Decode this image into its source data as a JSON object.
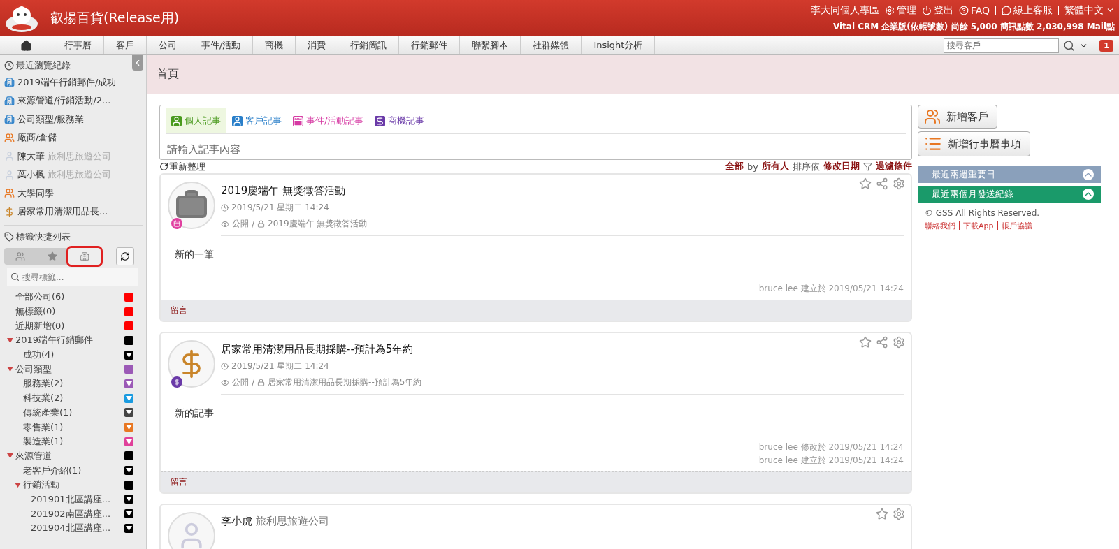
{
  "header": {
    "brand": "叡揚百貨(Release用)",
    "links": [
      {
        "kind": "text",
        "label": "李大同個人專區"
      },
      {
        "kind": "gear",
        "label": "管理"
      },
      {
        "kind": "power",
        "label": "登出"
      },
      {
        "kind": "help",
        "label": "FAQ"
      },
      {
        "kind": "chat",
        "label": "線上客服"
      },
      {
        "kind": "lang",
        "label": "繁體中文"
      }
    ],
    "account": "Vital CRM 企業版(依帳號數)  尚餘 5,000 簡訊點數 2,030,998 Mail點"
  },
  "nav": {
    "tabs": [
      "行事曆",
      "客戶",
      "公司",
      "事件/活動",
      "商機",
      "消費",
      "行銷簡訊",
      "行銷郵件",
      "聯繫腳本",
      "社群媒體",
      "Insight分析"
    ],
    "search_placeholder": "搜尋客戶",
    "badge": "1"
  },
  "sidebar": {
    "recent_title": "最近瀏覽紀錄",
    "recent": [
      {
        "kind": "tag-blue",
        "label": "2019端午行銷郵件/成功"
      },
      {
        "kind": "tag-blue",
        "label": "來源管道/行銷活動/2..."
      },
      {
        "kind": "tag-blue",
        "label": "公司類型/服務業"
      },
      {
        "kind": "tag-orange",
        "label": "廠商/倉儲"
      },
      {
        "kind": "person",
        "label": "陳大華",
        "company": "旅利思旅遊公司"
      },
      {
        "kind": "person",
        "label": "葉小楓",
        "company": "旅利思旅遊公司"
      },
      {
        "kind": "tag-orange",
        "label": "大學同學"
      },
      {
        "kind": "moneybag",
        "label": "居家常用清潔用品長..."
      }
    ],
    "tags_title": "標籤快捷列表",
    "tag_tabs": [
      {
        "kind": "people",
        "selected": false
      },
      {
        "kind": "star",
        "selected": false
      },
      {
        "kind": "company",
        "selected": true
      }
    ],
    "tag_search_placeholder": "搜尋標籤...",
    "tags": [
      {
        "label": "全部公司(6)",
        "kind": "plain",
        "color": "#ff0000"
      },
      {
        "label": "無標籤(0)",
        "kind": "plain",
        "color": "#ff0000"
      },
      {
        "label": "近期新增(0)",
        "kind": "plain",
        "color": "#ff0000"
      },
      {
        "label": "2019端午行銷郵件",
        "kind": "plain",
        "color": "#000000",
        "expanded": true,
        "children": [
          {
            "label": "成功(4)",
            "kind": "menu",
            "color": "#000000"
          }
        ]
      },
      {
        "label": "公司類型",
        "kind": "plain",
        "color": "#9b59b6",
        "expanded": true,
        "children": [
          {
            "label": "服務業(2)",
            "kind": "menu",
            "color": "#9b59b6"
          },
          {
            "label": "科技業(2)",
            "kind": "menu",
            "color": "#1a9be0"
          },
          {
            "label": "傳統產業(1)",
            "kind": "menu",
            "color": "#444444"
          },
          {
            "label": "零售業(1)",
            "kind": "menu",
            "color": "#e87722"
          },
          {
            "label": "製造業(1)",
            "kind": "menu",
            "color": "#e0409a"
          }
        ]
      },
      {
        "label": "來源管道",
        "kind": "plain",
        "color": "#000000",
        "expanded": true,
        "children": [
          {
            "label": "老客戶介紹(1)",
            "kind": "menu",
            "color": "#000000"
          },
          {
            "label": "行銷活動",
            "kind": "plain",
            "color": "#000000",
            "expanded": true,
            "children": [
              {
                "label": "201901北區講座...",
                "kind": "menu",
                "color": "#000000"
              },
              {
                "label": "201902南區講座...",
                "kind": "menu",
                "color": "#000000"
              },
              {
                "label": "201904北區講座...",
                "kind": "menu",
                "color": "#000000"
              }
            ]
          }
        ]
      }
    ]
  },
  "page_title": "首頁",
  "composer": {
    "tabs": [
      {
        "kind": "personal",
        "label": "個人記事",
        "selected": true
      },
      {
        "kind": "customer",
        "label": "客戶記事",
        "selected": false
      },
      {
        "kind": "event",
        "label": "事件/活動記事",
        "selected": false
      },
      {
        "kind": "deal",
        "label": "商機記事",
        "selected": false
      }
    ],
    "placeholder": "請輸入記事內容"
  },
  "feed_bar": {
    "refresh": "重新整理",
    "scope": "全部",
    "by": "by",
    "owner": "所有人",
    "sort_label": "排序依",
    "sort": "修改日期",
    "filter": "過濾條件"
  },
  "posts": [
    {
      "avatar": {
        "kind": "briefcase"
      },
      "badge": {
        "kind": "event"
      },
      "title": "2019慶端午 無獎徵答活動",
      "date": "2019/5/21 星期二 14:24",
      "visibility": "公開",
      "sep": "/",
      "related": "2019慶端午 無獎徵答活動",
      "body": "新的一筆",
      "footer": [
        "bruce lee 建立於 2019/05/21 14:24"
      ],
      "comment": "留言",
      "share": true
    },
    {
      "avatar": {
        "kind": "moneybag"
      },
      "badge": {
        "kind": "deal"
      },
      "title": "居家常用清潔用品長期採購--預計為5年約",
      "date": "2019/5/21 星期二 14:24",
      "visibility": "公開",
      "sep": "/",
      "related": "居家常用清潔用品長期採購--預計為5年約",
      "body": "新的記事",
      "footer": [
        "bruce lee 修改於 2019/05/21 14:24",
        "bruce lee 建立於 2019/05/21 14:24"
      ],
      "comment": "留言",
      "share": true
    },
    {
      "avatar": {
        "kind": "person"
      },
      "title": "李小虎",
      "company": "旅利思旅遊公司",
      "share": false
    }
  ],
  "actions": [
    {
      "kind": "customer",
      "label": "新增客戶"
    },
    {
      "kind": "calendar",
      "label": "新增行事曆事項"
    }
  ],
  "widgets": [
    {
      "label": "最近兩週重要日",
      "color": "#8aa0bb"
    },
    {
      "label": "最近兩個月發送紀錄",
      "color": "#1a9a6a"
    }
  ],
  "copyright": "© GSS All Rights Reserved.",
  "footer_links": [
    "聯絡我們",
    "下載App",
    "帳戶協議"
  ]
}
